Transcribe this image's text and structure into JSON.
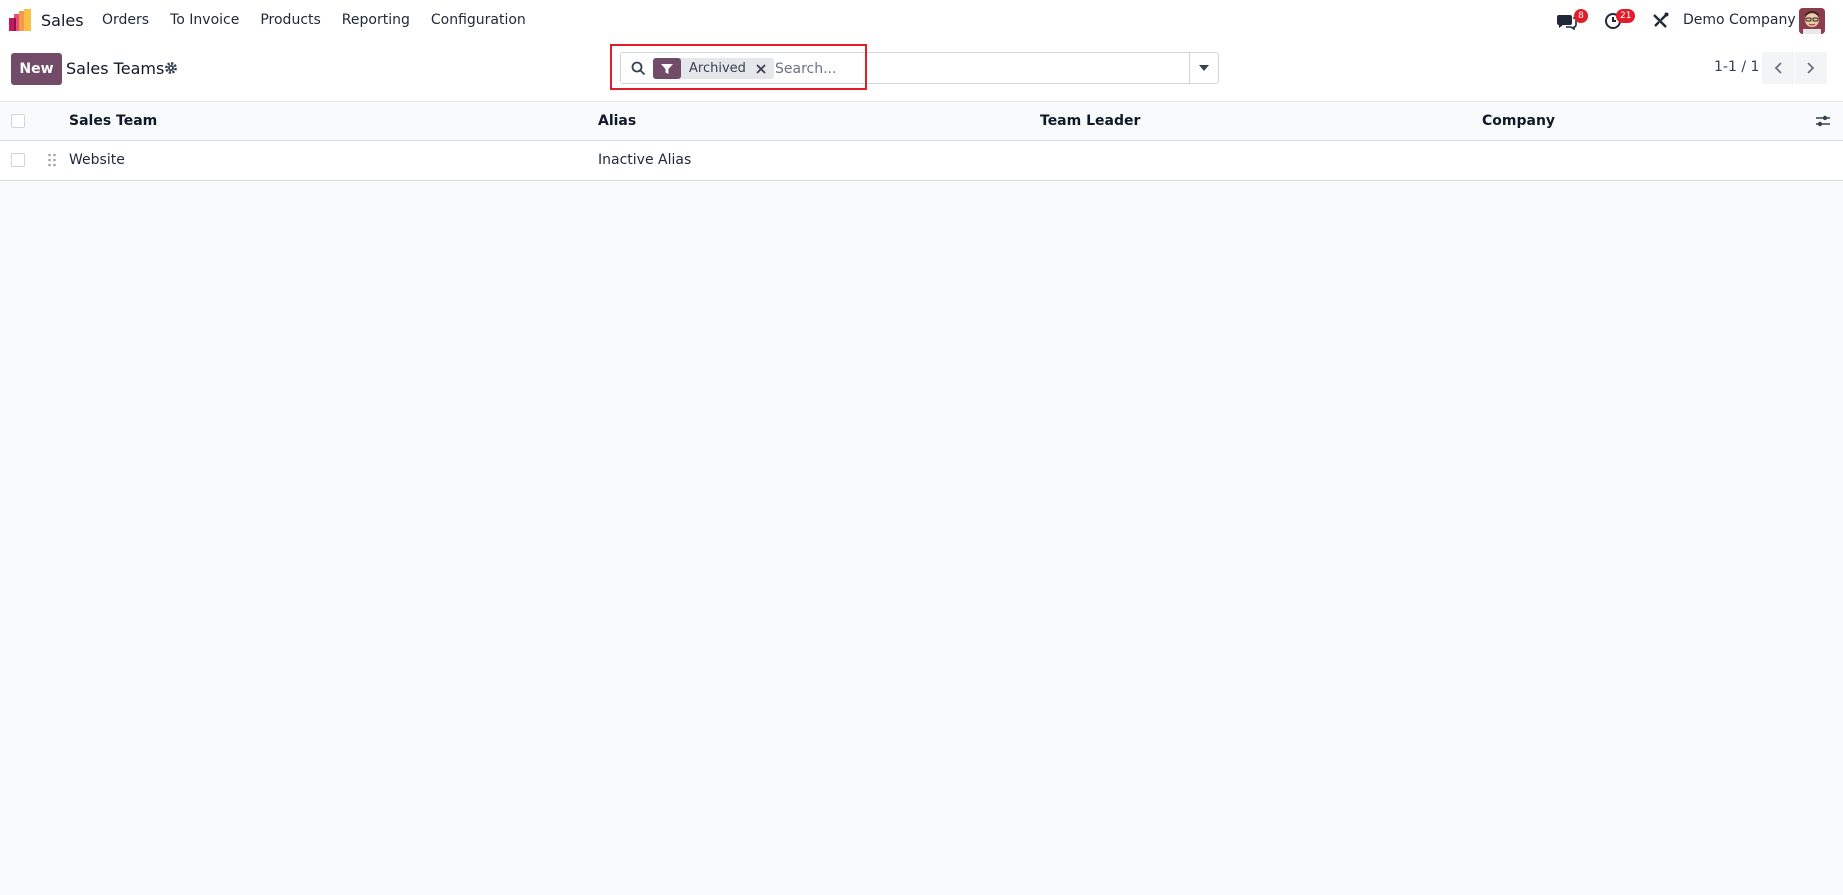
{
  "navbar": {
    "app_name": "Sales",
    "menu": [
      "Orders",
      "To Invoice",
      "Products",
      "Reporting",
      "Configuration"
    ],
    "messages_count": "8",
    "activities_count": "21",
    "company": "Demo Company"
  },
  "control": {
    "new_label": "New",
    "breadcrumb": "Sales Teams",
    "facet_label": "Archived",
    "search_placeholder": "Search...",
    "pager": "1-1 / 1"
  },
  "table": {
    "columns": [
      "Sales Team",
      "Alias",
      "Team Leader",
      "Company"
    ],
    "rows": [
      {
        "sales_team": "Website",
        "alias": "Inactive Alias",
        "team_leader": "",
        "company": ""
      }
    ]
  },
  "colors": {
    "brand": "#714b67",
    "badge": "#e11d2a",
    "highlight": "#e11d2a"
  }
}
